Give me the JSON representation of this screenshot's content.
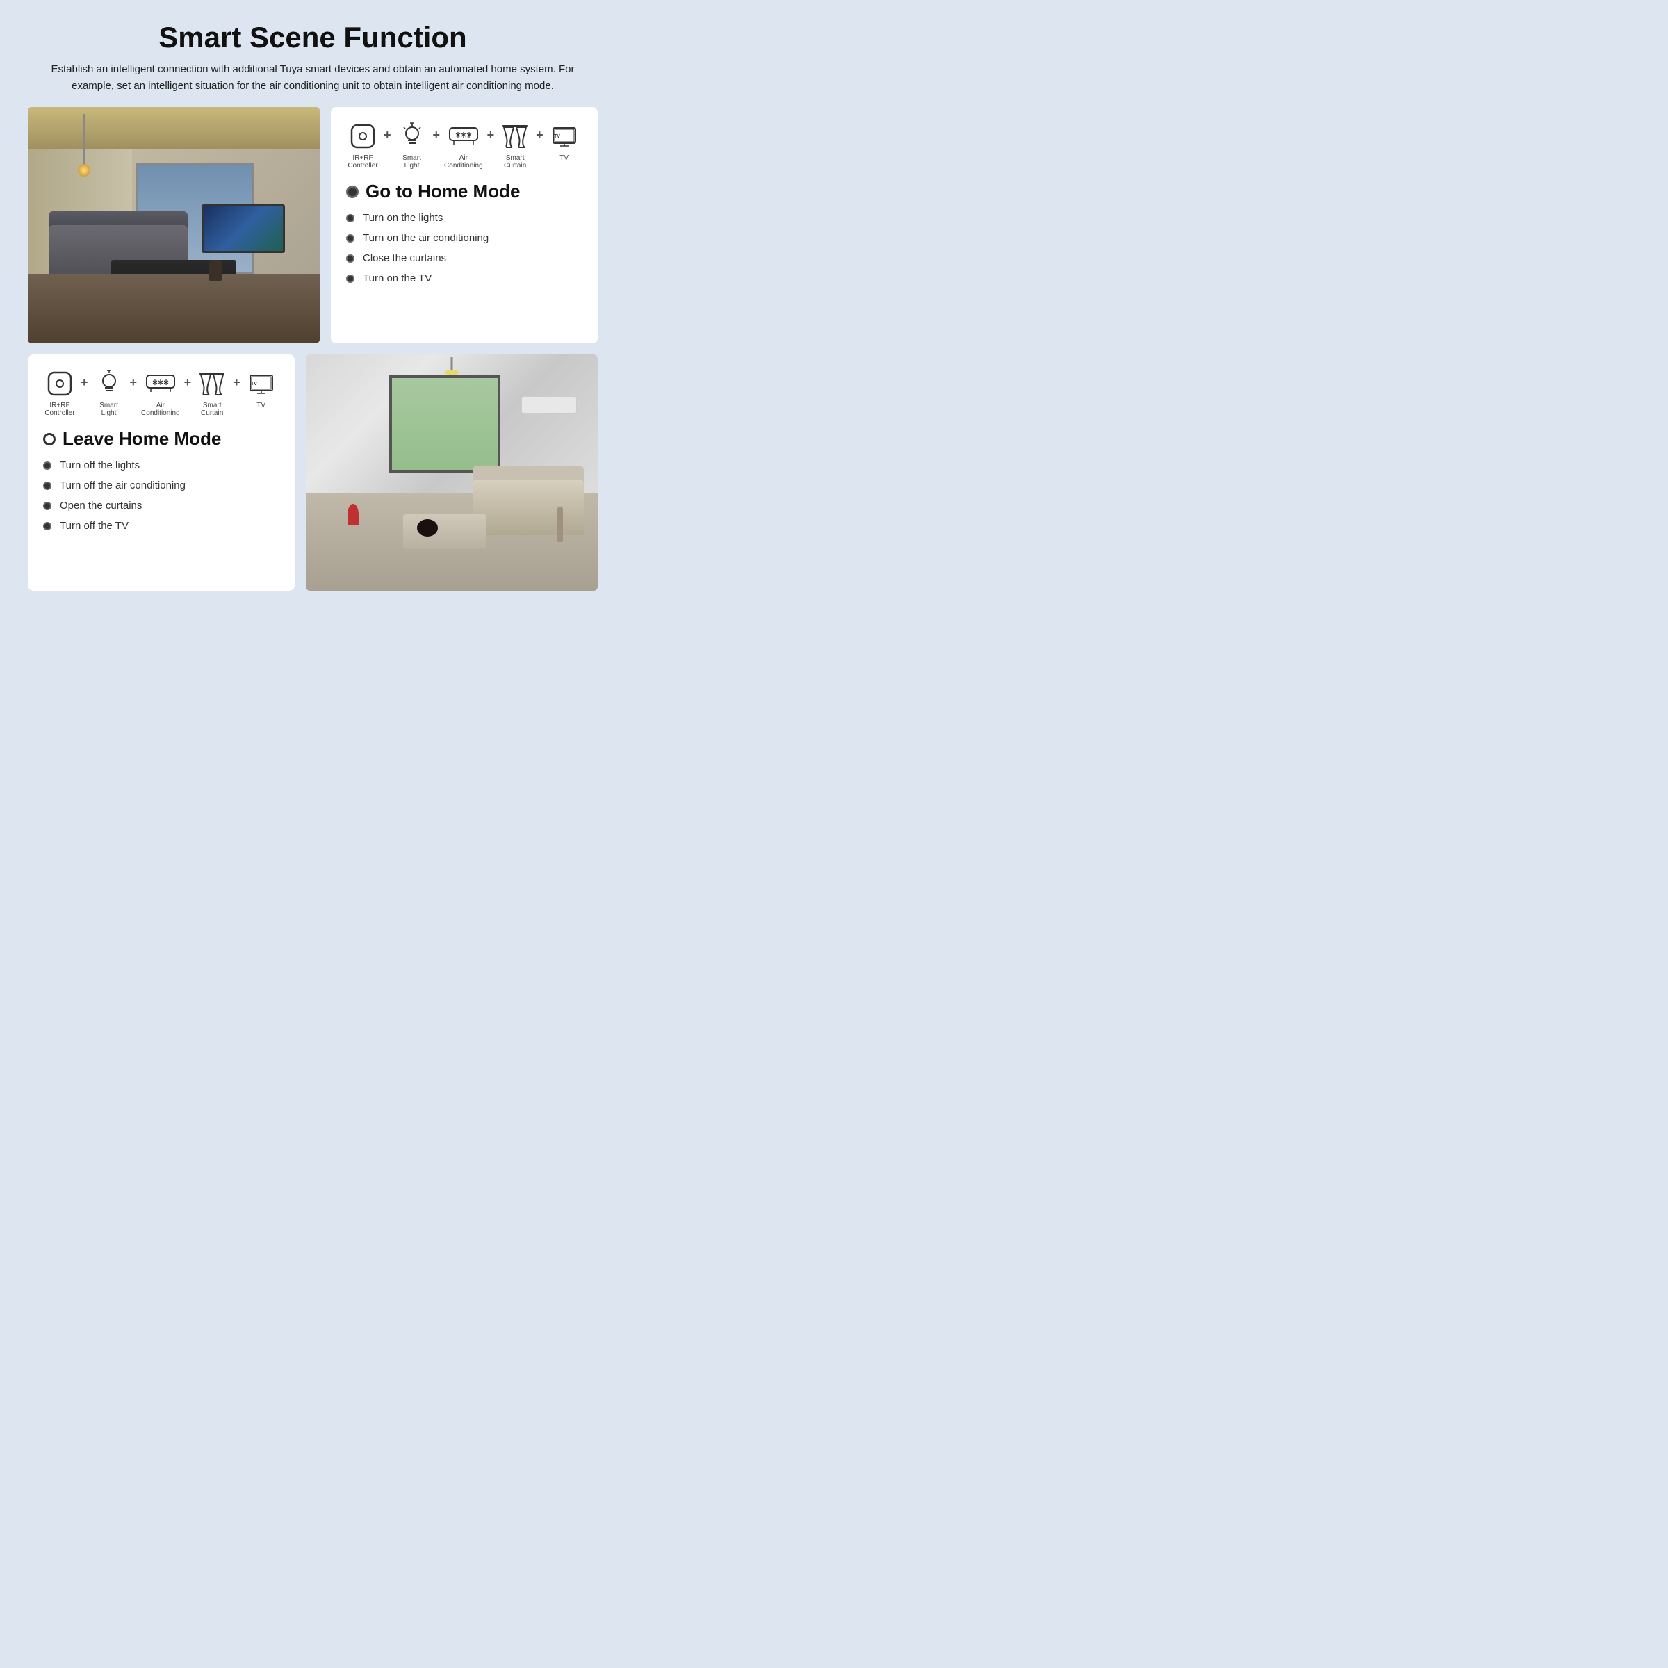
{
  "page": {
    "title": "Smart Scene Function",
    "subtitle": "Establish an intelligent connection with additional Tuya smart devices and obtain an automated home system. For example, set an intelligent situation for the air conditioning unit to obtain intelligent air conditioning mode.",
    "bg_color": "#dde6f0"
  },
  "top_section": {
    "devices": [
      {
        "id": "ir_rf",
        "label": "IR+RF\nController"
      },
      {
        "id": "smart_light",
        "label": "Smart\nLight"
      },
      {
        "id": "air_conditioning",
        "label": "Air\nConditioning"
      },
      {
        "id": "smart_curtain",
        "label": "Smart\nCurtain"
      },
      {
        "id": "tv",
        "label": "TV"
      }
    ],
    "mode": {
      "title": "Go to Home Mode",
      "actions": [
        "Turn on the lights",
        "Turn on the air conditioning",
        "Close the curtains",
        "Turn on the TV"
      ]
    }
  },
  "bottom_section": {
    "devices": [
      {
        "id": "ir_rf",
        "label": "IR+RF\nController"
      },
      {
        "id": "smart_light",
        "label": "Smart\nLight"
      },
      {
        "id": "air_conditioning",
        "label": "Air\nConditioning"
      },
      {
        "id": "smart_curtain",
        "label": "Smart\nCurtain"
      },
      {
        "id": "tv",
        "label": "TV"
      }
    ],
    "mode": {
      "title": "Leave Home Mode",
      "actions": [
        "Turn off the lights",
        "Turn off the air conditioning",
        "Open the curtains",
        "Turn off the TV"
      ]
    }
  }
}
